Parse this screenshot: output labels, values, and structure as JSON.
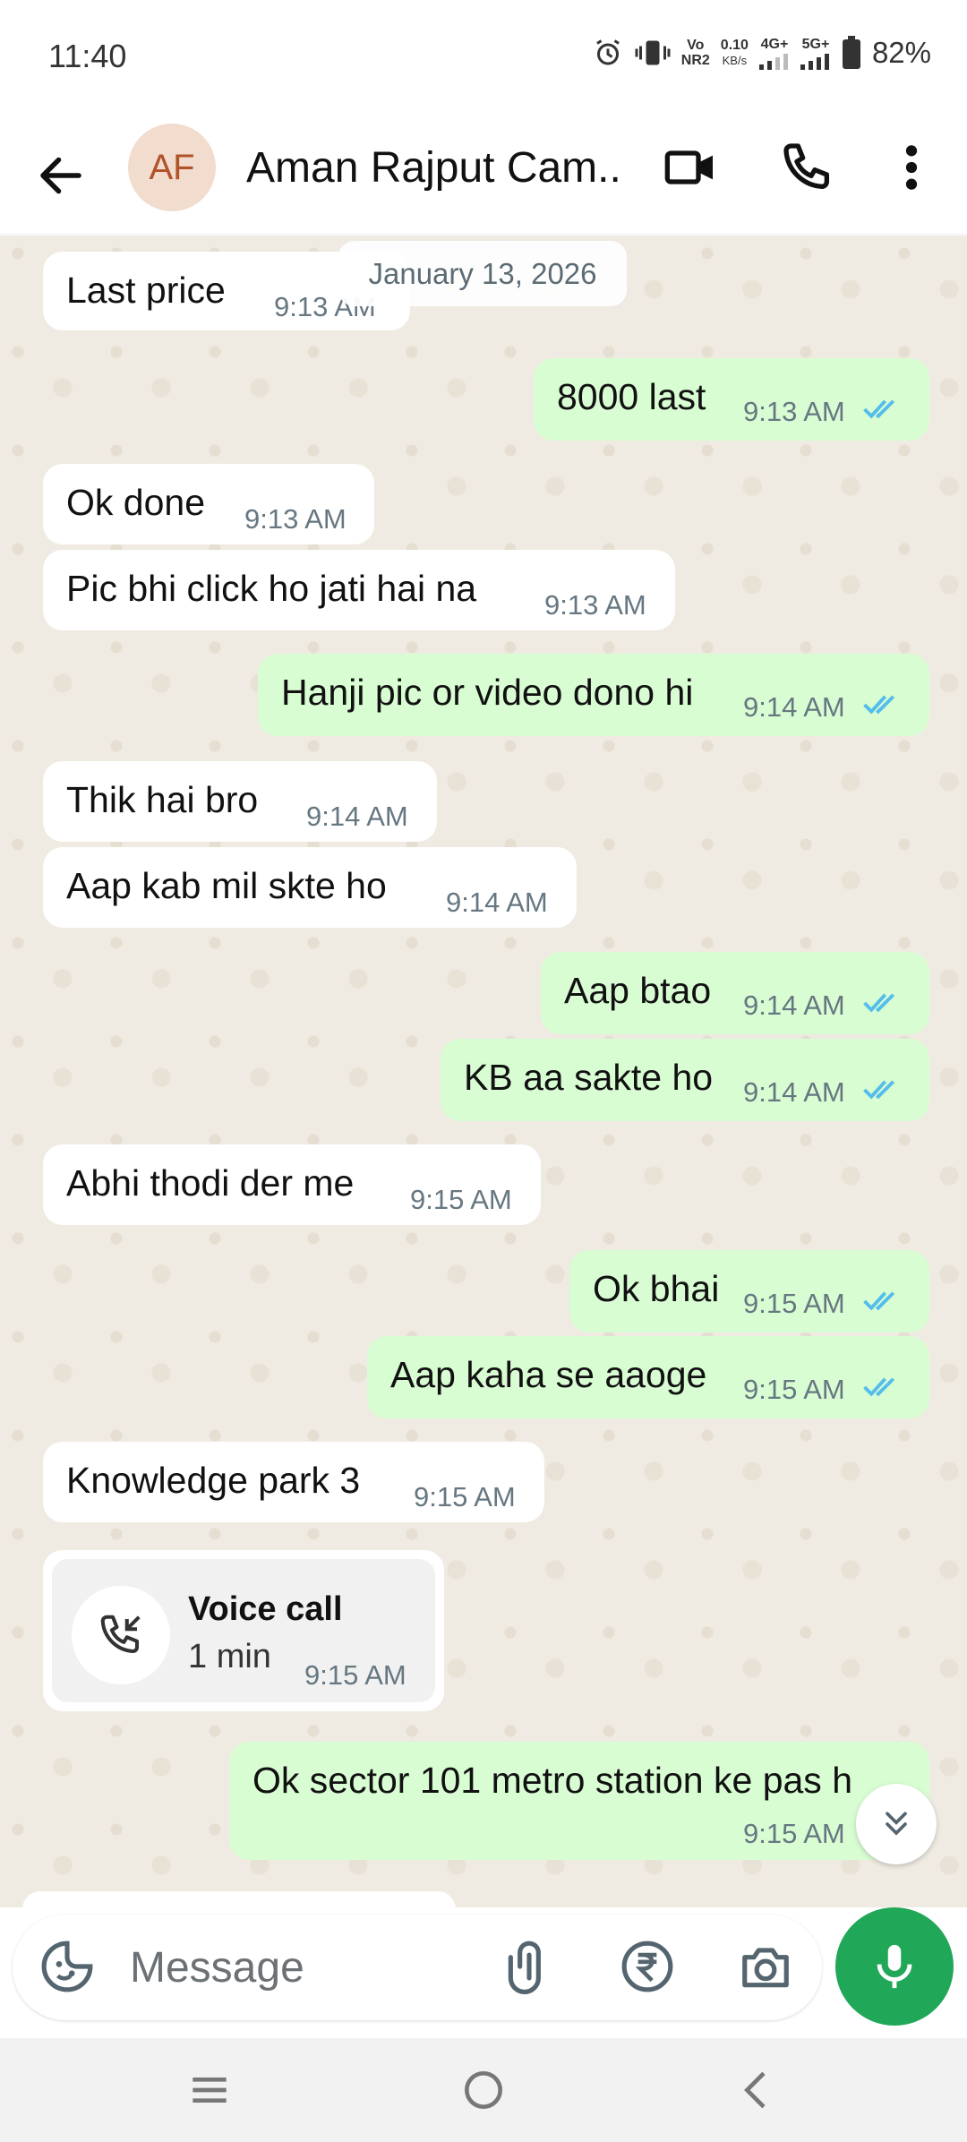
{
  "status_bar": {
    "time": "11:40",
    "volte_top": "Vo",
    "volte_bottom": "NR2",
    "speed_value": "0.10",
    "speed_unit": "KB/s",
    "net1": "4G+",
    "net2": "5G+",
    "battery": "82%"
  },
  "header": {
    "avatar_initials": "AF",
    "contact_name": "Aman Rajput Cam...",
    "icons": [
      "back-arrow-icon",
      "video-call-icon",
      "phone-icon",
      "more-vert-icon"
    ]
  },
  "date_divider": "January 13, 2026",
  "messages": [
    {
      "dir": "in",
      "text": "Last price",
      "time": "9:13 AM"
    },
    {
      "dir": "out",
      "text": "8000 last",
      "time": "9:13 AM",
      "read": true
    },
    {
      "dir": "in",
      "text": "Ok done",
      "time": "9:13 AM"
    },
    {
      "dir": "in",
      "text": "Pic bhi click ho jati hai na",
      "time": "9:13 AM"
    },
    {
      "dir": "out",
      "text": "Hanji pic or video dono hi",
      "time": "9:14 AM",
      "read": true
    },
    {
      "dir": "in",
      "text": "Thik hai bro",
      "time": "9:14 AM"
    },
    {
      "dir": "in",
      "text": "Aap kab mil skte ho",
      "time": "9:14 AM"
    },
    {
      "dir": "out",
      "text": "Aap btao",
      "time": "9:14 AM",
      "read": true
    },
    {
      "dir": "out",
      "text": "KB aa sakte ho",
      "time": "9:14 AM",
      "read": true
    },
    {
      "dir": "in",
      "text": "Abhi thodi der me",
      "time": "9:15 AM"
    },
    {
      "dir": "out",
      "text": "Ok bhai",
      "time": "9:15 AM",
      "read": true
    },
    {
      "dir": "out",
      "text": "Aap kaha se aaoge",
      "time": "9:15 AM",
      "read": true
    },
    {
      "dir": "in",
      "text": "Knowledge park 3",
      "time": "9:15 AM"
    },
    {
      "dir": "out",
      "text": "Ok sector 101 metro station ke pas h",
      "time": "9:15 AM",
      "read": true
    }
  ],
  "voice_call": {
    "title": "Voice call",
    "duration": "1 min",
    "time": "9:15 AM"
  },
  "input": {
    "placeholder": "Message"
  },
  "colors": {
    "outgoing_bubble": "#d9fdd3",
    "incoming_bubble": "#ffffff",
    "chat_bg": "#efeae2",
    "read_ticks": "#53bdeb",
    "mic_button": "#21a758"
  }
}
